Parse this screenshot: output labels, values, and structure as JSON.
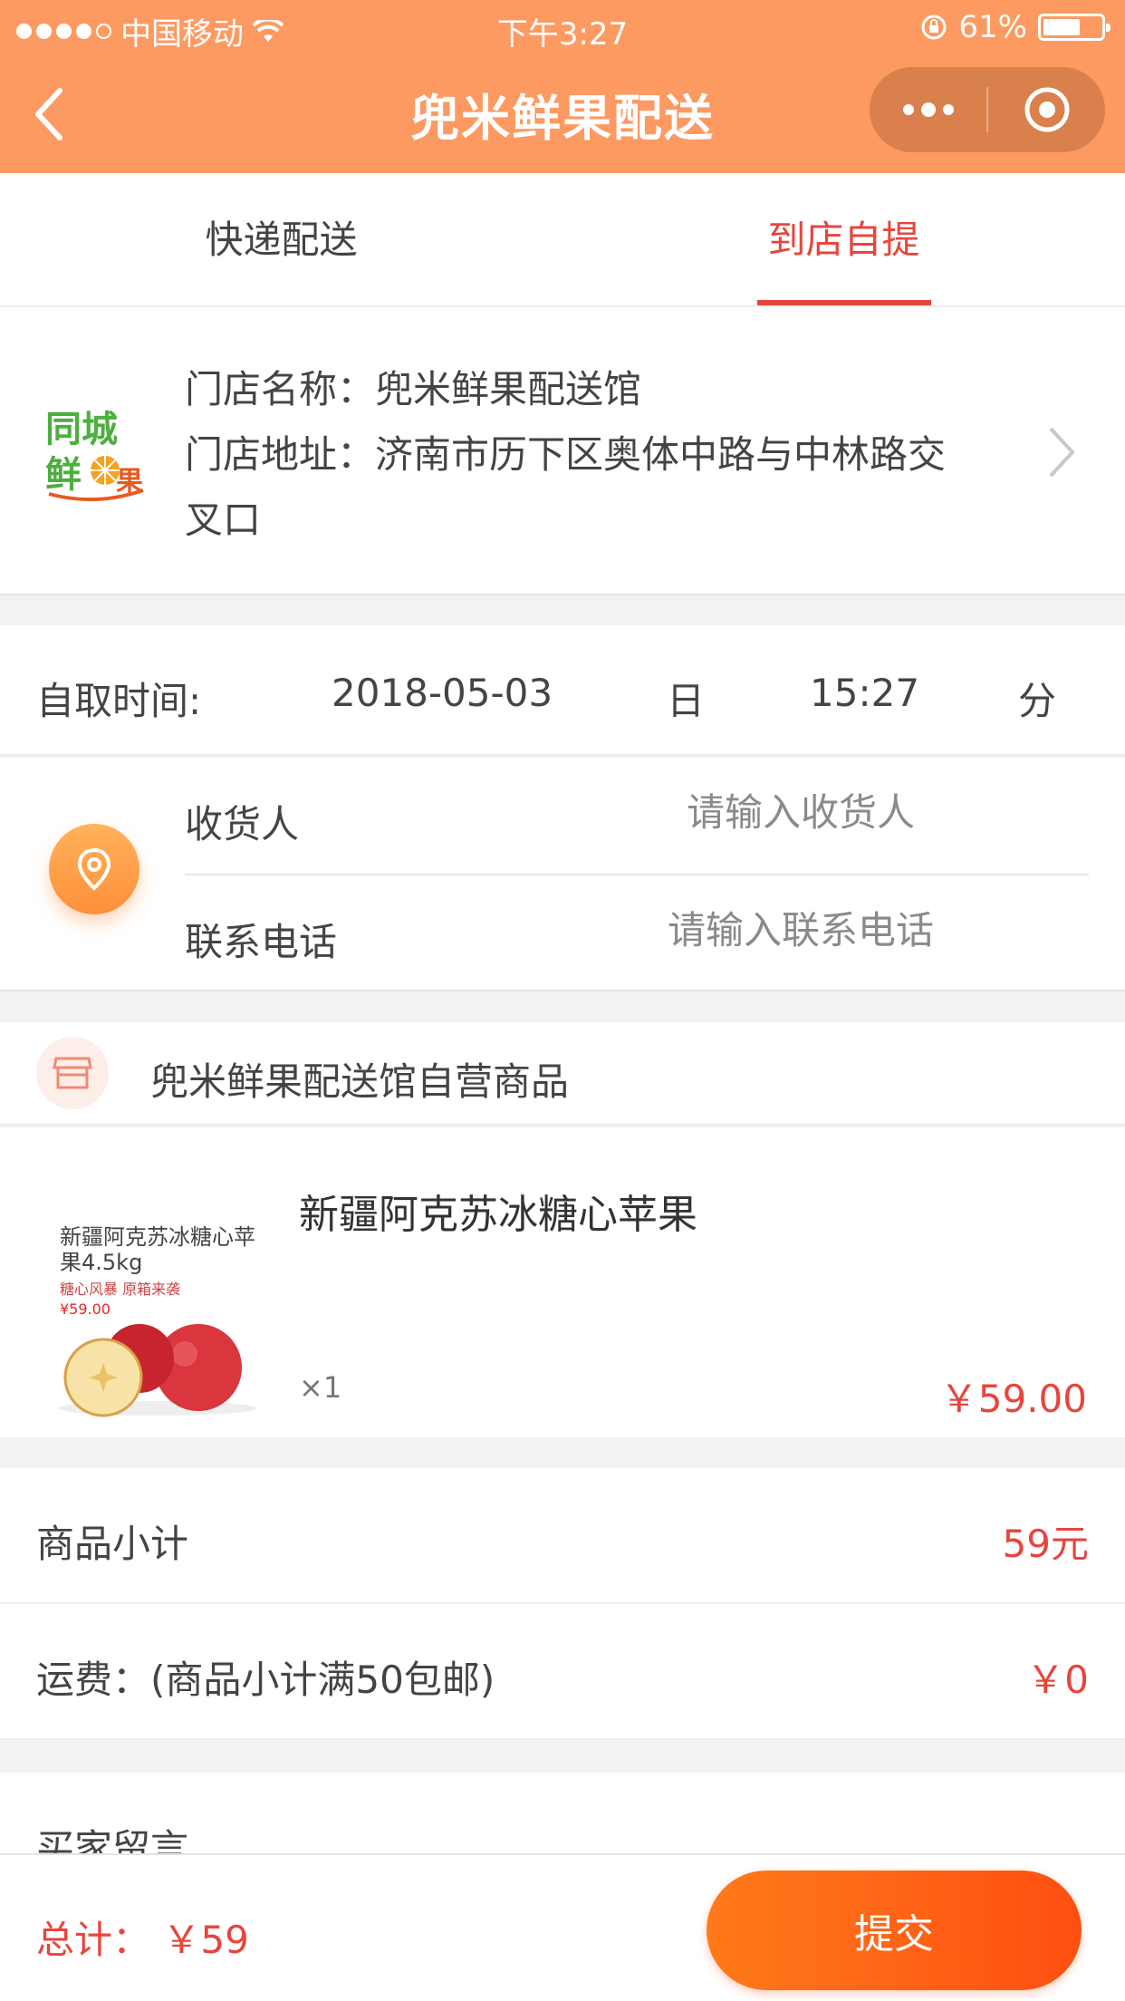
{
  "status_bar": {
    "carrier": "中国移动",
    "time": "下午3:27",
    "battery": "61%"
  },
  "nav": {
    "title": "兜米鲜果配送"
  },
  "tabs": [
    {
      "label": "快递配送",
      "active": false
    },
    {
      "label": "到店自提",
      "active": true
    }
  ],
  "store": {
    "name_label": "门店名称：兜米鲜果配送馆",
    "address_line1": "门店地址：济南市历下区奥体中路与中林路交",
    "address_line2": "叉口",
    "logo_text_1": "同城",
    "logo_text_2": "鲜果"
  },
  "pickup": {
    "label": "自取时间:",
    "date": "2018-05-03",
    "day_unit": "日",
    "time": "15:27",
    "minute_unit": "分"
  },
  "contact": {
    "receiver_label": "收货人",
    "receiver_placeholder": "请输入收货人",
    "phone_label": "联系电话",
    "phone_placeholder": "请输入联系电话"
  },
  "shop": {
    "name": "兜米鲜果配送馆自营商品"
  },
  "product": {
    "title": "新疆阿克苏冰糖心苹果",
    "image_text_title": "新疆阿克苏冰糖心苹果4.5kg",
    "image_text_sub": "糖心风暴 原箱来袭",
    "image_text_price": "¥59.00",
    "quantity": "×1",
    "price": "￥59.00"
  },
  "summary": {
    "subtotal_label": "商品小计",
    "subtotal_value": "59元",
    "shipping_label": "运费：(商品小计满50包邮)",
    "shipping_value": "￥0"
  },
  "message": {
    "label": "买家留言"
  },
  "bottom": {
    "total": "总计： ￥59",
    "submit_label": "提交"
  },
  "colors": {
    "header": "#fd9a62",
    "accent_red": "#e8453c",
    "submit_start": "#ff7a1a",
    "submit_end": "#ff4f12"
  }
}
